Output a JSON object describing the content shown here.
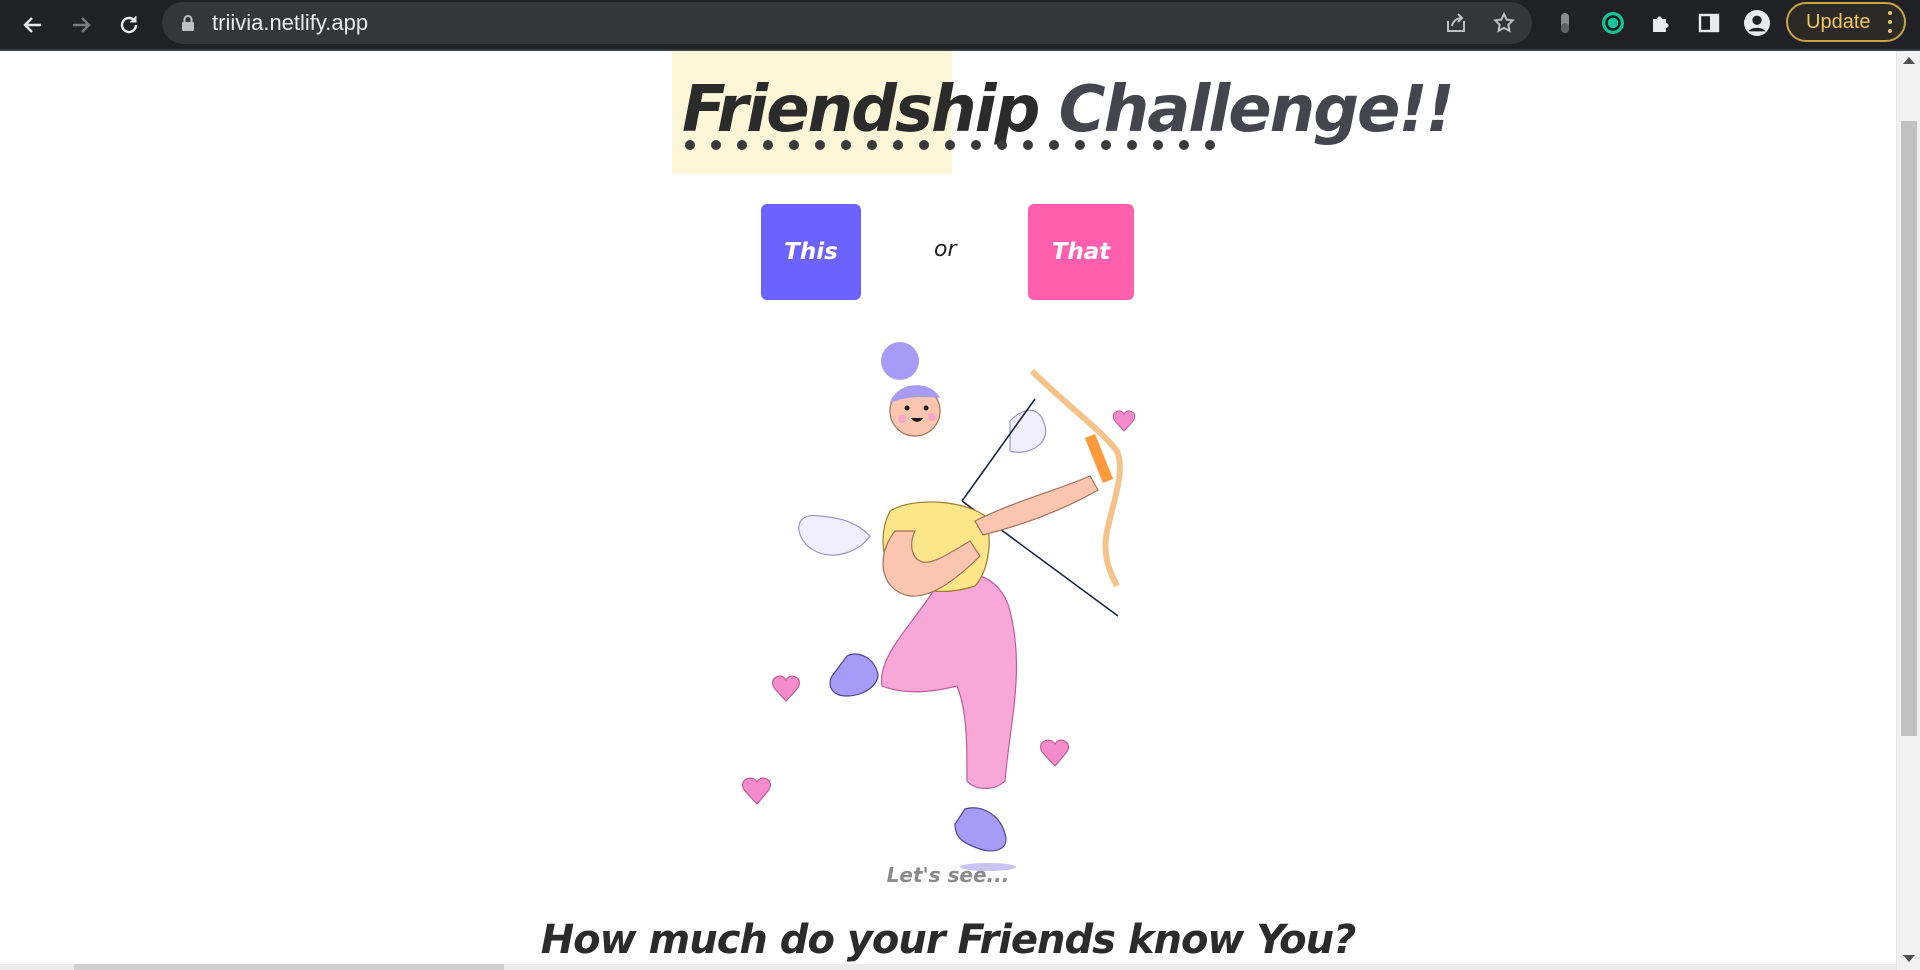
{
  "browser": {
    "url": "triivia.netlify.app",
    "update_label": "Update"
  },
  "page": {
    "title_word1": "Friendship",
    "title_word2": "Challenge!!",
    "this_label": "This",
    "or_label": "or",
    "that_label": "That",
    "lets_see": "Let's see...",
    "question": "How much do your Friends know You?"
  },
  "colors": {
    "this_button": "#6c63ff",
    "that_button": "#ff5fac",
    "title_highlight": "#fdf6d9"
  }
}
